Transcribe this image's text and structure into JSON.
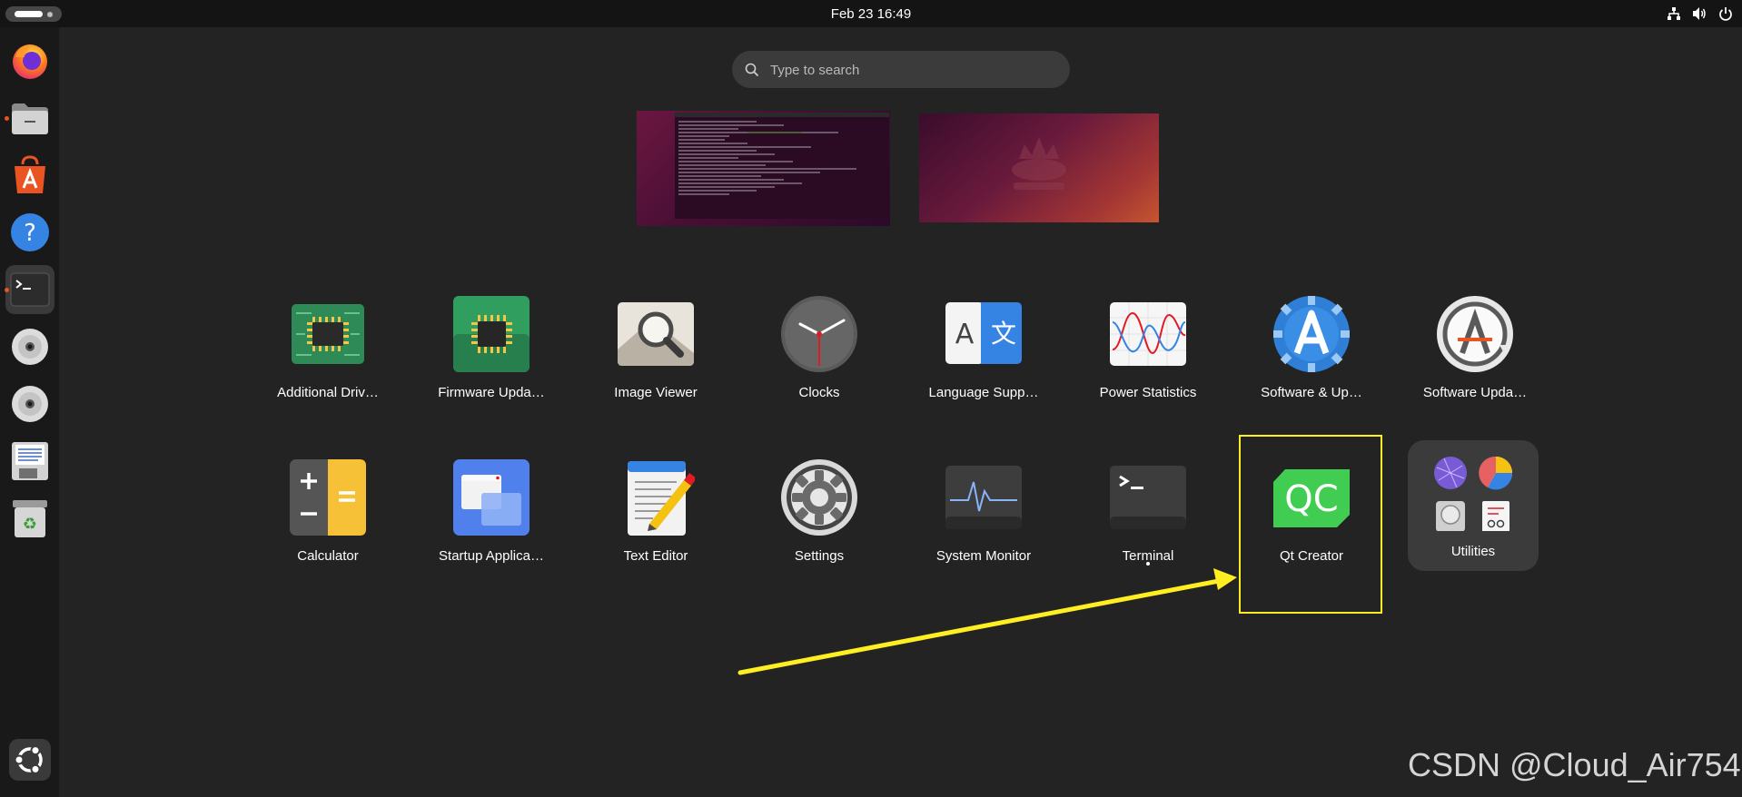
{
  "topbar": {
    "datetime": "Feb 23  16:49",
    "tray_icons": [
      "network-icon",
      "volume-icon",
      "power-icon"
    ]
  },
  "dock": {
    "items": [
      {
        "name": "firefox",
        "icon": "firefox-icon",
        "running": false
      },
      {
        "name": "files",
        "icon": "folder-icon",
        "running": true
      },
      {
        "name": "app-center",
        "icon": "app-center-icon",
        "running": false
      },
      {
        "name": "help",
        "icon": "help-icon",
        "running": false
      },
      {
        "name": "terminal",
        "icon": "terminal-icon",
        "running": true,
        "active": true
      },
      {
        "name": "disc-1",
        "icon": "disc-icon",
        "running": false
      },
      {
        "name": "disc-2",
        "icon": "disc-icon",
        "running": false
      },
      {
        "name": "floppy",
        "icon": "floppy-icon",
        "running": false
      },
      {
        "name": "trash",
        "icon": "trash-icon",
        "running": false
      }
    ],
    "show_apps_icon": "ubuntu-logo-icon"
  },
  "search": {
    "placeholder": "Type to search"
  },
  "workspaces": [
    "workspace-1",
    "workspace-2"
  ],
  "apps": {
    "row1": [
      {
        "label": "Additional Driv…",
        "icon": "chip-board-icon"
      },
      {
        "label": "Firmware Upda…",
        "icon": "firmware-chip-icon"
      },
      {
        "label": "Image Viewer",
        "icon": "image-viewer-icon"
      },
      {
        "label": "Clocks",
        "icon": "clock-icon"
      },
      {
        "label": "Language Supp…",
        "icon": "language-icon"
      },
      {
        "label": "Power Statistics",
        "icon": "power-statistics-icon"
      },
      {
        "label": "Software & Up…",
        "icon": "software-sources-icon"
      },
      {
        "label": "Software Upda…",
        "icon": "software-updater-icon"
      }
    ],
    "row2": [
      {
        "label": "Calculator",
        "icon": "calculator-icon"
      },
      {
        "label": "Startup Applica…",
        "icon": "startup-apps-icon"
      },
      {
        "label": "Text Editor",
        "icon": "text-editor-icon"
      },
      {
        "label": "Settings",
        "icon": "settings-gear-icon"
      },
      {
        "label": "System Monitor",
        "icon": "system-monitor-icon"
      },
      {
        "label": "Terminal",
        "icon": "terminal-icon"
      },
      {
        "label": "Qt Creator",
        "icon": "qt-creator-icon"
      },
      {
        "label": "Utilities",
        "icon": "folder-grid-icon"
      }
    ]
  },
  "annotation": {
    "highlight_color": "#ffee22",
    "arrow_color": "#ffee22"
  },
  "colors": {
    "accent": "#e95420",
    "panel": "#141414",
    "background": "#232323",
    "qt_green": "#41cd52"
  },
  "watermark": "CSDN @Cloud_Air754"
}
